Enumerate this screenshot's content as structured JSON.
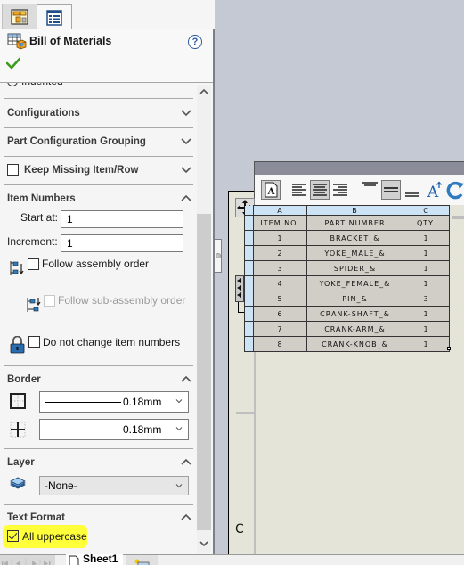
{
  "panel": {
    "tabs": [
      {
        "name": "configuration-manager",
        "icon": "configuration-manager-icon"
      },
      {
        "name": "property-manager",
        "icon": "property-manager-icon",
        "active": true
      }
    ],
    "title": "Bill of Materials",
    "help": "?",
    "ok": "✔",
    "clipped_option": "Indented",
    "sections": {
      "configurations": "Configurations",
      "part_config_grouping": "Part Configuration Grouping",
      "keep_missing": "Keep Missing Item/Row",
      "item_numbers": {
        "title": "Item Numbers",
        "start_at_label": "Start at:",
        "start_at_value": "1",
        "increment_label": "Increment:",
        "increment_value": "1",
        "follow_assembly_order": "Follow assembly order",
        "follow_subassembly_order": "Follow sub-assembly order",
        "do_not_change": "Do not change item numbers"
      },
      "border": {
        "title": "Border",
        "box_border_value": "0.18mm",
        "grid_border_value": "0.18mm"
      },
      "layer": {
        "title": "Layer",
        "value": "-None-"
      },
      "text_format": {
        "title": "Text Format",
        "all_uppercase": "All uppercase",
        "all_uppercase_checked": true
      }
    }
  },
  "sheet_tabs": {
    "active": "Sheet1"
  },
  "drawing": {
    "zone_label": "C",
    "table": {
      "column_letters": [
        "A",
        "B",
        "C"
      ],
      "headers": [
        "ITEM NO.",
        "PART NUMBER",
        "QTY."
      ],
      "rows": [
        [
          "1",
          "BRACKET_&",
          "1"
        ],
        [
          "2",
          "YOKE_MALE_&",
          "1"
        ],
        [
          "3",
          "SPIDER_&",
          "1"
        ],
        [
          "4",
          "YOKE_FEMALE_&",
          "1"
        ],
        [
          "5",
          "PIN_&",
          "3"
        ],
        [
          "6",
          "CRANK-SHAFT_&",
          "1"
        ],
        [
          "7",
          "CRANK-ARM_&",
          "1"
        ],
        [
          "8",
          "CRANK-KNOB_&",
          "1"
        ]
      ]
    },
    "toolbar": [
      "use-document-font",
      "align-left",
      "align-center",
      "align-right",
      "align-top",
      "align-middle",
      "align-bottom",
      "table-header-top",
      "refresh"
    ]
  },
  "colors": {
    "highlight": "#ffff3a",
    "column_header_bg": "#cce3f5",
    "table_cell_bg": "#d0cec6",
    "sheet_bg": "#e4e4d9",
    "viewport_bg": "#c5c9d4",
    "ok_green": "#3c9a1e",
    "help_blue": "#2b5b9c"
  }
}
